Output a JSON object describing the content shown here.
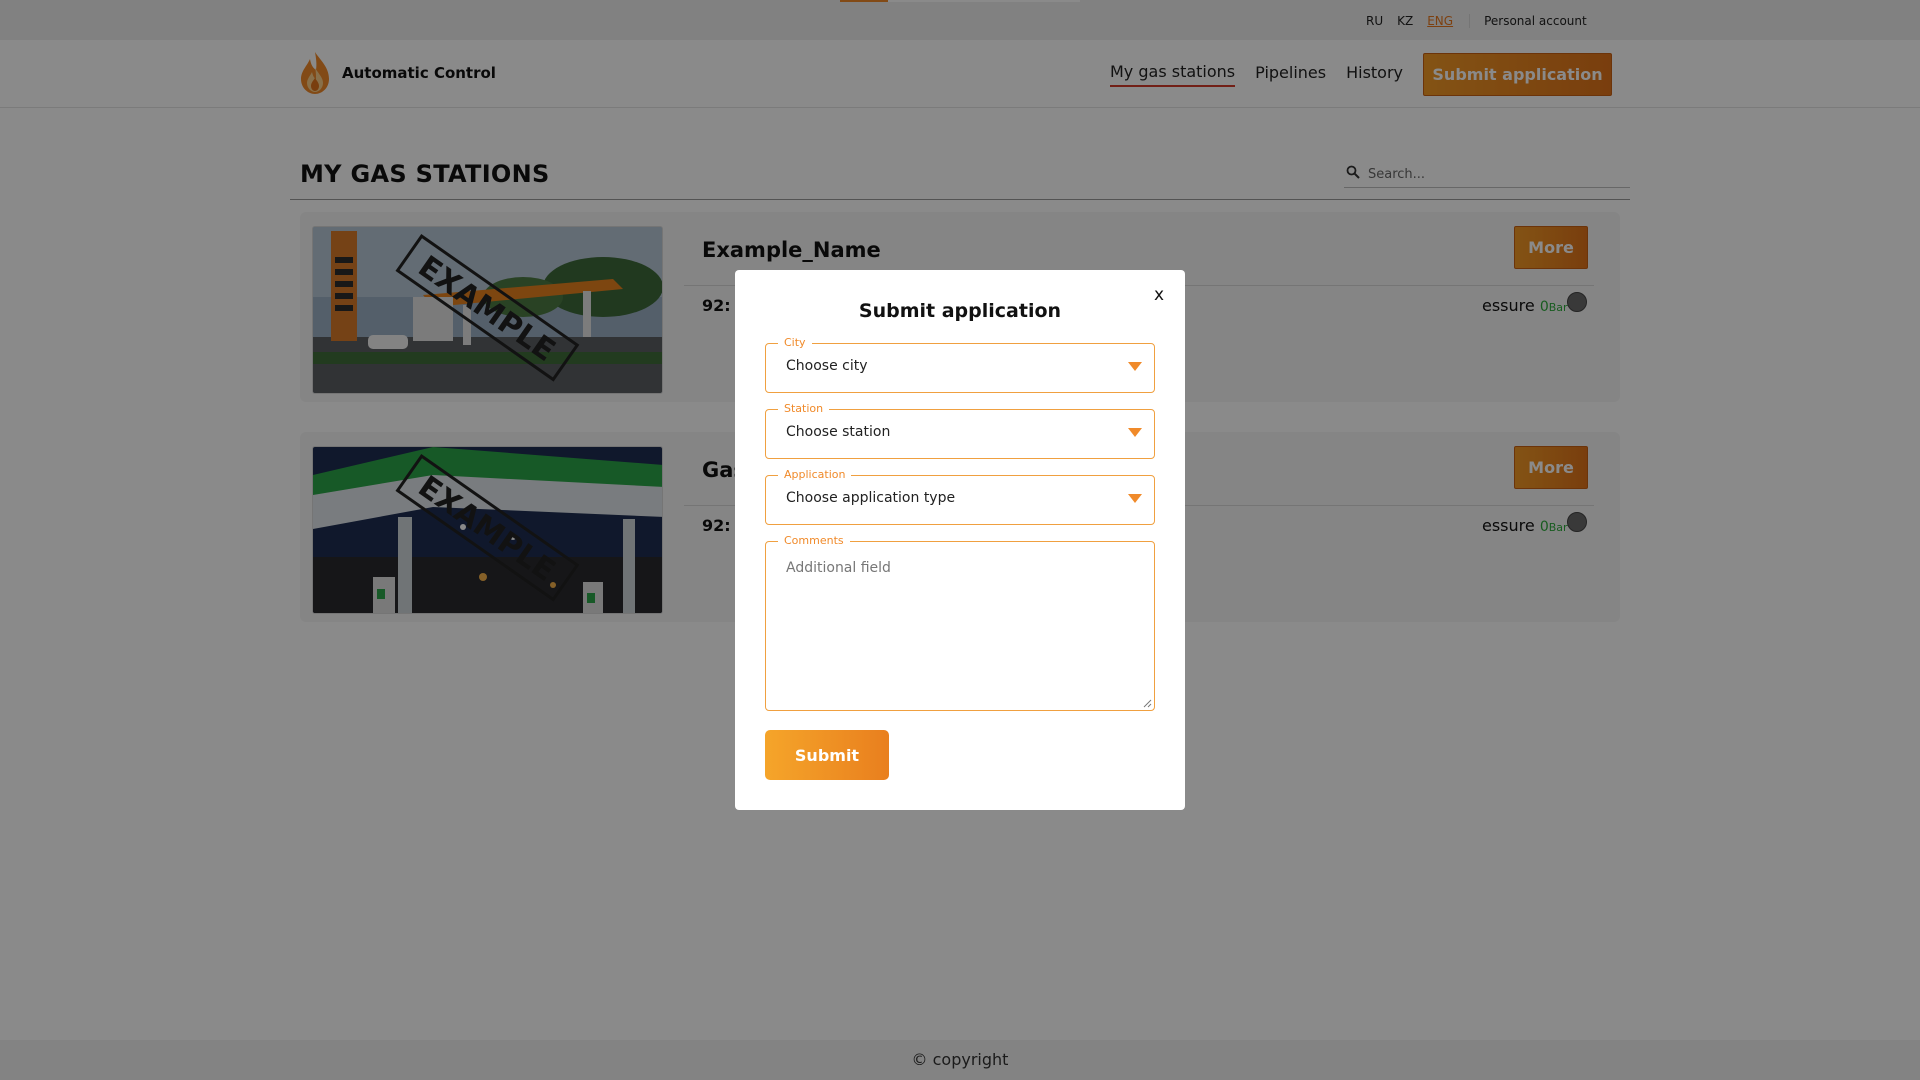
{
  "languages": [
    {
      "code": "RU",
      "active": false
    },
    {
      "code": "KZ",
      "active": false
    },
    {
      "code": "ENG",
      "active": true
    }
  ],
  "account_link": "Personal account",
  "brand": {
    "name": "Automatic Control",
    "logo_icon": "flame-icon"
  },
  "nav": {
    "items": [
      {
        "label": "My gas stations",
        "active": true
      },
      {
        "label": "Pipelines",
        "active": false
      },
      {
        "label": "History",
        "active": false
      }
    ],
    "cta": "Submit application"
  },
  "main": {
    "title": "MY GAS STATIONS",
    "search": {
      "placeholder": "Search...",
      "icon": "search-icon"
    },
    "cards": [
      {
        "name": "Example_Name",
        "fuel_label": "92:",
        "pressure_label": "essure",
        "pressure_value": "0",
        "pressure_unit": "Bar",
        "more": "More",
        "watermark": "EXAMPLE"
      },
      {
        "name": "Gas",
        "fuel_label": "92:",
        "pressure_label": "essure",
        "pressure_value": "0",
        "pressure_unit": "Bar",
        "more": "More",
        "watermark": "EXAMPLE"
      }
    ]
  },
  "footer": {
    "text": "© copyright"
  },
  "modal": {
    "close_label": "x",
    "title": "Submit application",
    "fields": {
      "city": {
        "legend": "City",
        "value": "Choose city"
      },
      "station": {
        "legend": "Station",
        "value": "Choose station"
      },
      "application": {
        "legend": "Application",
        "value": "Choose application type"
      },
      "comments": {
        "legend": "Comments",
        "placeholder": "Additional field"
      }
    },
    "submit_label": "Submit"
  },
  "colors": {
    "accent": "#f08a2a",
    "nav_active_underline": "#d23a2a",
    "pressure_ok": "#2eaa3c",
    "overlay": "rgba(0,0,0,0.46)"
  }
}
